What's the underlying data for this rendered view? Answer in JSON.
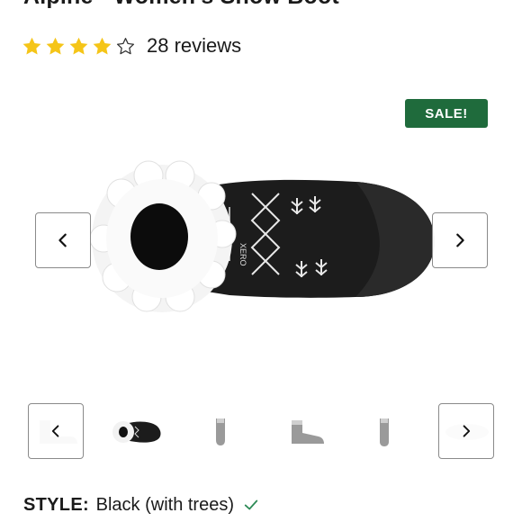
{
  "product": {
    "title": "Alpine - Women's Snow Boot",
    "rating": {
      "stars_filled": 4,
      "stars_total": 5,
      "reviews_label": "28 reviews"
    },
    "badge": "SALE!",
    "style": {
      "label": "STYLE",
      "value": "Black (with trees)"
    }
  },
  "gallery": {
    "prev_icon": "chevron-left-icon",
    "next_icon": "chevron-right-icon",
    "thumbnail_count": 7
  },
  "colors": {
    "star": "#F5C518",
    "sale_badge": "#1F6B3C",
    "check": "#2E8B57",
    "border": "#8A8A8A"
  }
}
